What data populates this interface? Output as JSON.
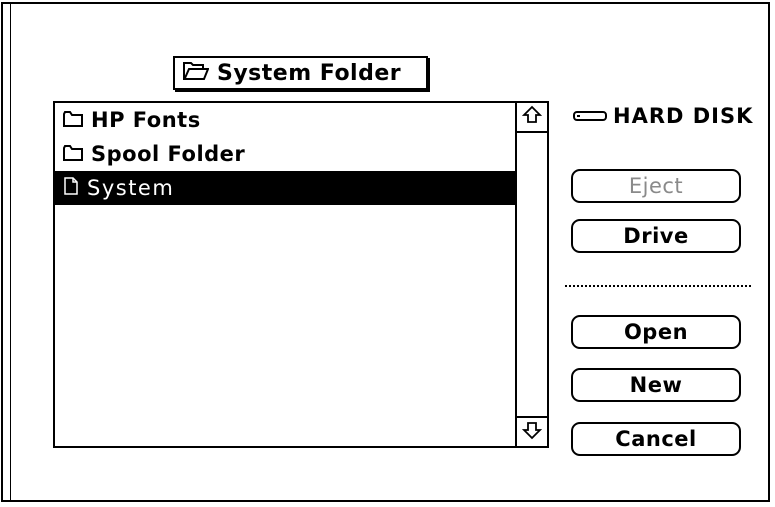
{
  "dialog": {
    "current_folder": "System Folder",
    "files": [
      {
        "name": "HP Fonts",
        "kind": "folder",
        "selected": false
      },
      {
        "name": "Spool Folder",
        "kind": "folder",
        "selected": false
      },
      {
        "name": "System",
        "kind": "document",
        "selected": true
      }
    ],
    "disk_name": "HARD DISK",
    "buttons": {
      "eject": "Eject",
      "drive": "Drive",
      "open": "Open",
      "new": "New",
      "cancel": "Cancel"
    },
    "icons": {
      "popup": "open-folder-icon",
      "disk": "hard-disk-icon",
      "scroll_up": "arrow-up-icon",
      "scroll_down": "arrow-down-icon"
    },
    "eject_enabled": false
  }
}
